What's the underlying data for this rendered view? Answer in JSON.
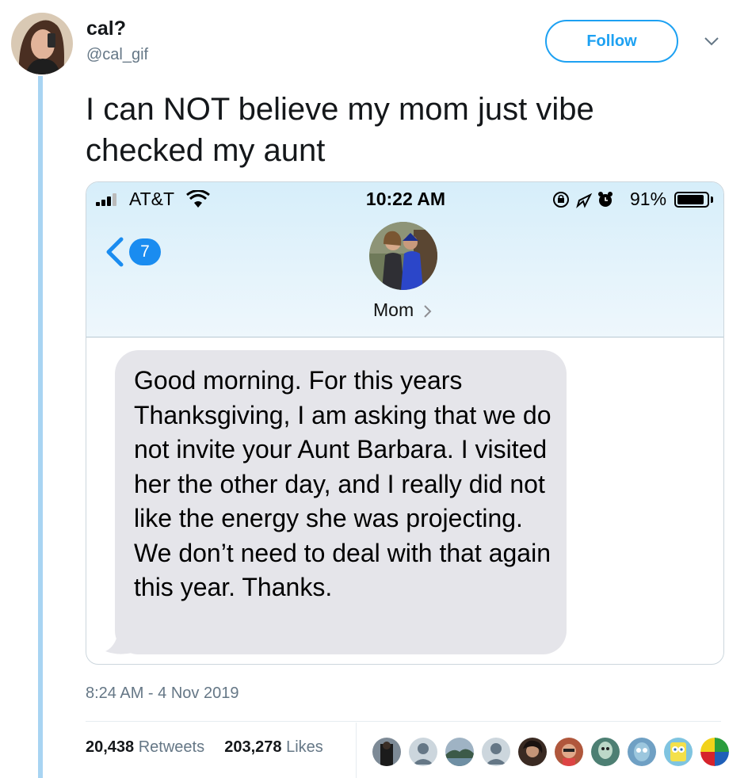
{
  "tweet": {
    "display_name": "cal?",
    "handle": "@cal_gif",
    "follow_label": "Follow",
    "text": "I can NOT believe my mom just vibe checked my aunt",
    "timestamp": "8:24 AM - 4 Nov 2019",
    "retweets_count": "20,438",
    "retweets_label": "Retweets",
    "likes_count": "203,278",
    "likes_label": "Likes"
  },
  "screenshot": {
    "carrier": "AT&T",
    "time": "10:22 AM",
    "battery": "91%",
    "battery_level": 0.91,
    "back_badge": "7",
    "contact_name": "Mom",
    "message": "Good morning. For this years Thanksgiving, I am asking that we do not invite your Aunt Barbara. I visited her the other day, and I really did not like the energy she was projecting. We don’t need to deal with that again this year. Thanks."
  },
  "colors": {
    "accent": "#1da1f2",
    "thread_line": "#a8d4f2",
    "secondary_text": "#657786",
    "bubble": "#e5e5ea",
    "ios_badge": "#1a8cf0"
  },
  "likers": [
    {
      "icon": "photo-avatar"
    },
    {
      "icon": "default-avatar"
    },
    {
      "icon": "photo-avatar"
    },
    {
      "icon": "default-avatar"
    },
    {
      "icon": "photo-avatar"
    },
    {
      "icon": "photo-avatar"
    },
    {
      "icon": "cartoon-avatar"
    },
    {
      "icon": "cartoon-avatar"
    },
    {
      "icon": "cartoon-avatar"
    },
    {
      "icon": "color-wheel-avatar"
    }
  ]
}
